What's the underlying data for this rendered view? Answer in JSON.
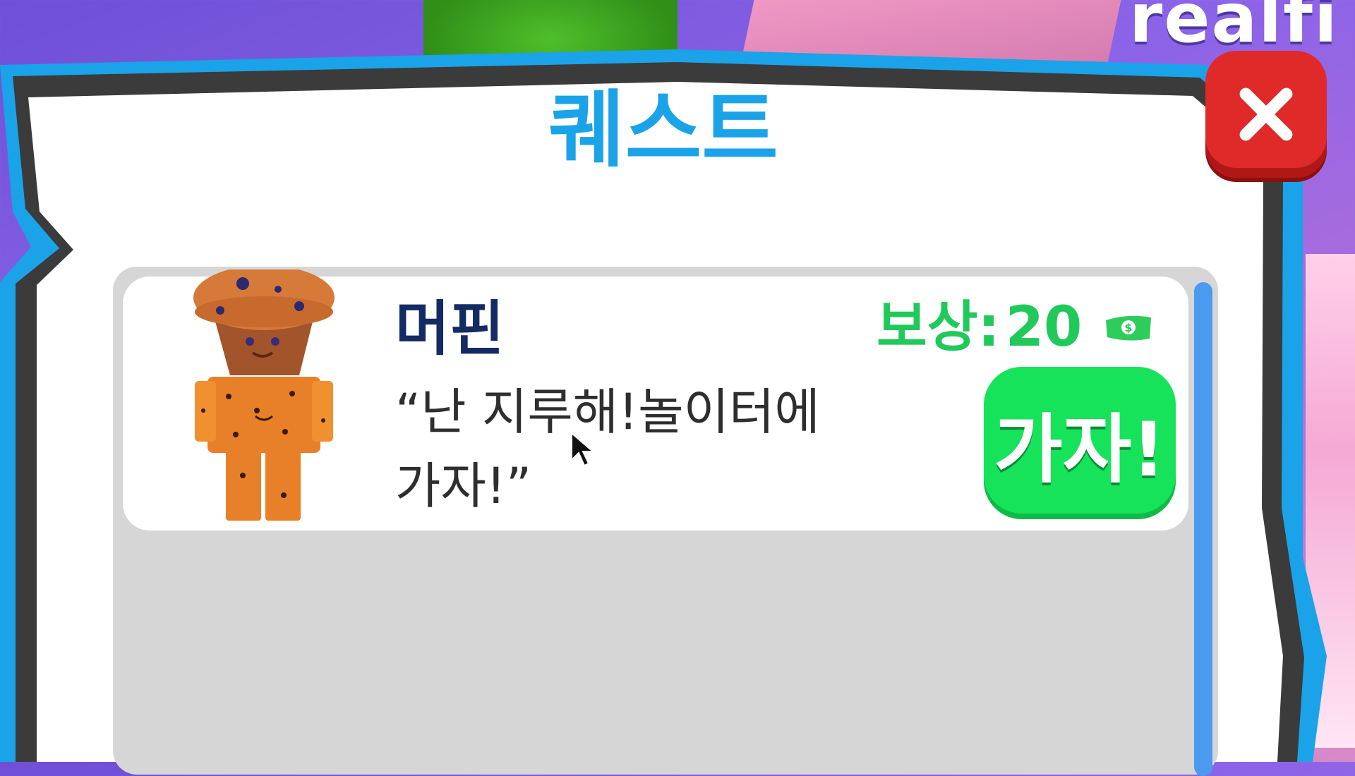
{
  "background": {
    "watermark_text": "realfi"
  },
  "quest_panel": {
    "title": "퀘스트",
    "close_icon": "close-x-icon",
    "colors": {
      "title": "#1aa3e8",
      "frame_blue": "#1aa3e8",
      "frame_dark": "#3b3b3b",
      "close": "#e02a2a"
    },
    "quests": [
      {
        "npc_name": "머핀",
        "avatar": "muffin-character",
        "message": "“난 지루해!놀이터에 가자!”",
        "reward_label": "보상:",
        "reward_value": "20",
        "reward_icon": "money-bill-icon",
        "action_label": "가자!",
        "colors": {
          "reward": "#21c95a",
          "action_button": "#16e35a",
          "name": "#142a63"
        }
      }
    ]
  }
}
